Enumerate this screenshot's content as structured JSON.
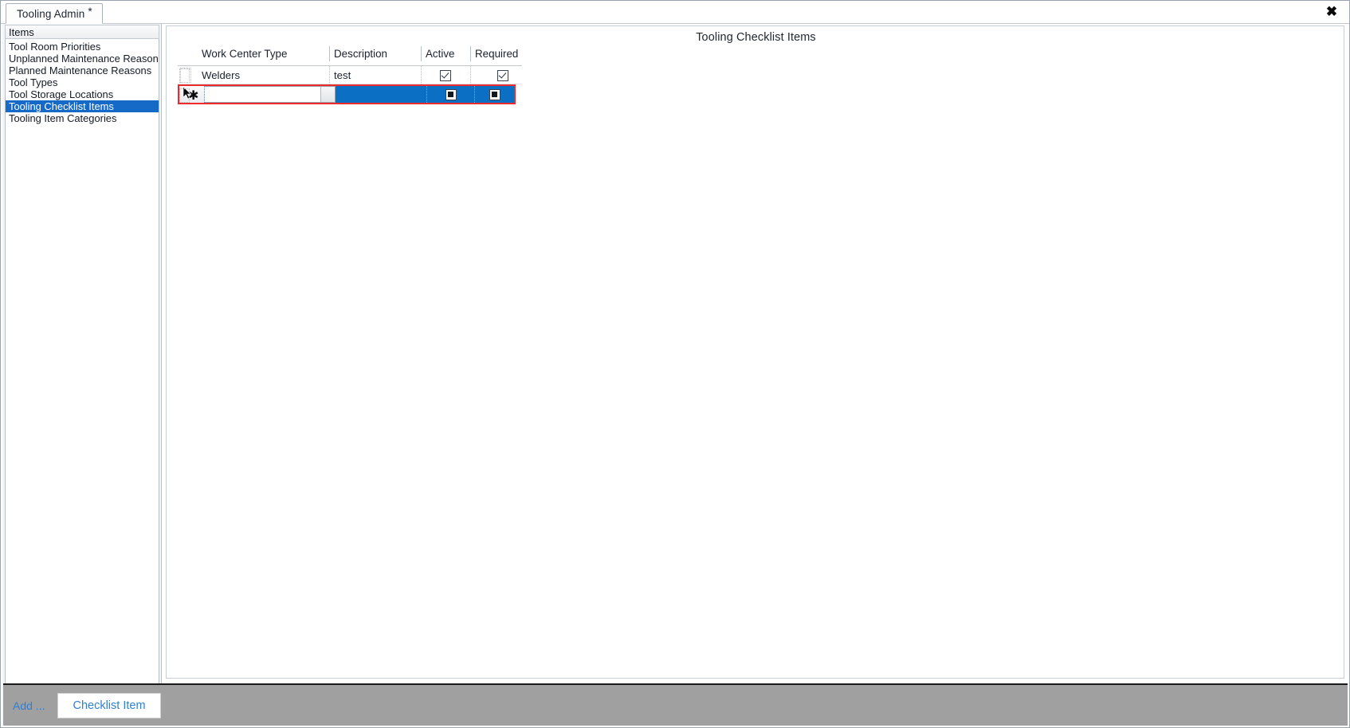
{
  "window": {
    "close_label": "✖"
  },
  "tab": {
    "label": "Tooling Admin",
    "dirty_marker": "*"
  },
  "sidebar": {
    "header": "Items",
    "items": [
      {
        "label": "Tool Room Priorities",
        "selected": false
      },
      {
        "label": "Unplanned Maintenance Reasons",
        "selected": false
      },
      {
        "label": "Planned Maintenance Reasons",
        "selected": false
      },
      {
        "label": "Tool Types",
        "selected": false
      },
      {
        "label": "Tool Storage Locations",
        "selected": false
      },
      {
        "label": "Tooling Checklist Items",
        "selected": true
      },
      {
        "label": "Tooling Item Categories",
        "selected": false
      }
    ]
  },
  "main": {
    "title": "Tooling Checklist Items",
    "grid": {
      "columns": [
        {
          "key": "work_center_type",
          "label": "Work Center Type"
        },
        {
          "key": "description",
          "label": "Description"
        },
        {
          "key": "active",
          "label": "Active"
        },
        {
          "key": "required",
          "label": "Required"
        }
      ],
      "rows": [
        {
          "work_center_type": "Welders",
          "description": "test",
          "active": "checked",
          "required": "checked"
        }
      ],
      "new_row": {
        "indicator": "✱",
        "work_center_type_value": "",
        "work_center_type_placeholder": "",
        "description": "",
        "active": "indeterminate",
        "required": "indeterminate",
        "dropdown_icon": "chevron-down-icon"
      }
    }
  },
  "bottombar": {
    "add_label": "Add ...",
    "checklist_item_button": "Checklist Item"
  },
  "colors": {
    "selection_blue": "#1569c7",
    "row_edit_blue": "#0b6fc4",
    "focus_red": "#ee2b2b",
    "toolbar_gray": "#a0a0a0",
    "link_blue": "#2f7fd4"
  }
}
